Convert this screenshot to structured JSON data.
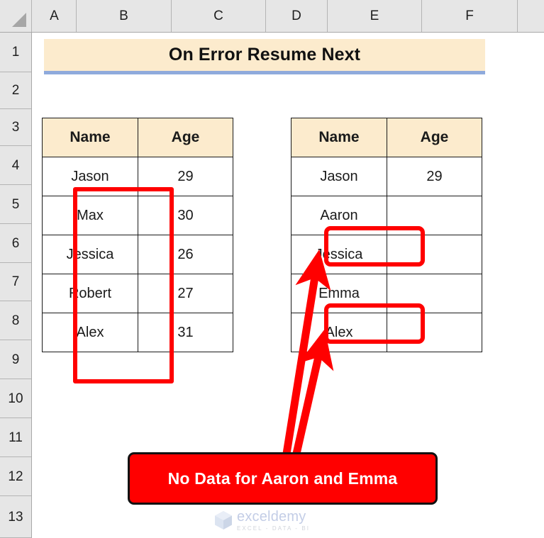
{
  "app": {
    "type": "spreadsheet",
    "corner_icon": "select-all-triangle-icon"
  },
  "grid": {
    "columns": [
      "A",
      "B",
      "C",
      "D",
      "E",
      "F"
    ],
    "rows": [
      "1",
      "2",
      "3",
      "4",
      "5",
      "6",
      "7",
      "8",
      "9",
      "10",
      "11",
      "12",
      "13"
    ]
  },
  "title_banner": {
    "text": "On Error Resume Next",
    "background": "#FCEBCD",
    "underline_color": "#8FAADC"
  },
  "tables": {
    "left": {
      "headers": [
        "Name",
        "Age"
      ],
      "rows": [
        {
          "name": "Jason",
          "age": "29"
        },
        {
          "name": "Max",
          "age": "30"
        },
        {
          "name": "Jessica",
          "age": "26"
        },
        {
          "name": "Robert",
          "age": "27"
        },
        {
          "name": "Alex",
          "age": "31"
        }
      ]
    },
    "right": {
      "headers": [
        "Name",
        "Age"
      ],
      "rows": [
        {
          "name": "Jason",
          "age": "29"
        },
        {
          "name": "Aaron",
          "age": ""
        },
        {
          "name": "Jessica",
          "age": ""
        },
        {
          "name": "Emma",
          "age": ""
        },
        {
          "name": "Alex",
          "age": ""
        }
      ]
    }
  },
  "annotations": {
    "highlight_color": "#FF0000",
    "highlight_left_label": "source-name-column-highlight",
    "highlight_aaron_label": "aaron-cell-highlight",
    "highlight_emma_label": "emma-cell-highlight",
    "callout": {
      "text": "No Data for Aaron and Emma",
      "background": "#FF0000",
      "text_color": "#FFFFFF",
      "border_color": "#111111"
    },
    "arrow_count": 2
  },
  "watermark": {
    "name": "exceldemy",
    "tagline": "EXCEL - DATA - BI",
    "color": "#9FB0D8"
  }
}
